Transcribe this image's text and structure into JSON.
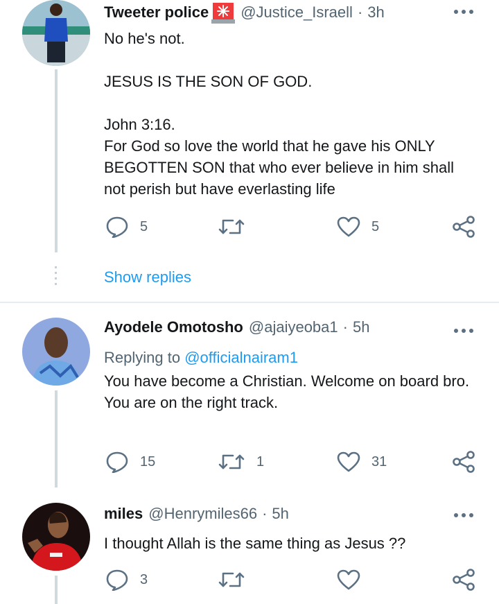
{
  "tweet1": {
    "name": "Tweeter police",
    "badge_icon": "rotating-light-emoji",
    "handle": "@Justice_Israell",
    "dot": "·",
    "time": "3h",
    "text": "No he's not.\n\nJESUS IS THE SON OF GOD.\n\nJohn 3:16.\nFor God so love the world that he gave his ONLY BEGOTTEN SON that who ever believe in him shall not perish but have everlasting life",
    "replies": "5",
    "retweets": "",
    "likes": "5"
  },
  "show_replies": "Show replies",
  "tweet2": {
    "name": "Ayodele Omotosho",
    "handle": "@ajaiyeoba1",
    "dot": "·",
    "time": "5h",
    "replying_prefix": "Replying to",
    "replying_to": "@officialnairam1",
    "text": "You have become a Christian. Welcome on board bro.\nYou are on the right track.",
    "replies": "15",
    "retweets": "1",
    "likes": "31"
  },
  "tweet3": {
    "name": "miles",
    "handle": "@Henrymiles66",
    "dot": "·",
    "time": "5h",
    "text": "I thought Allah is the same thing as Jesus ??",
    "replies": "3",
    "retweets": "",
    "likes": ""
  },
  "colors": {
    "link": "#1d9bf0",
    "secondary_text": "#536471",
    "icon": "#5b7083",
    "thread_line": "#cfd9de"
  }
}
